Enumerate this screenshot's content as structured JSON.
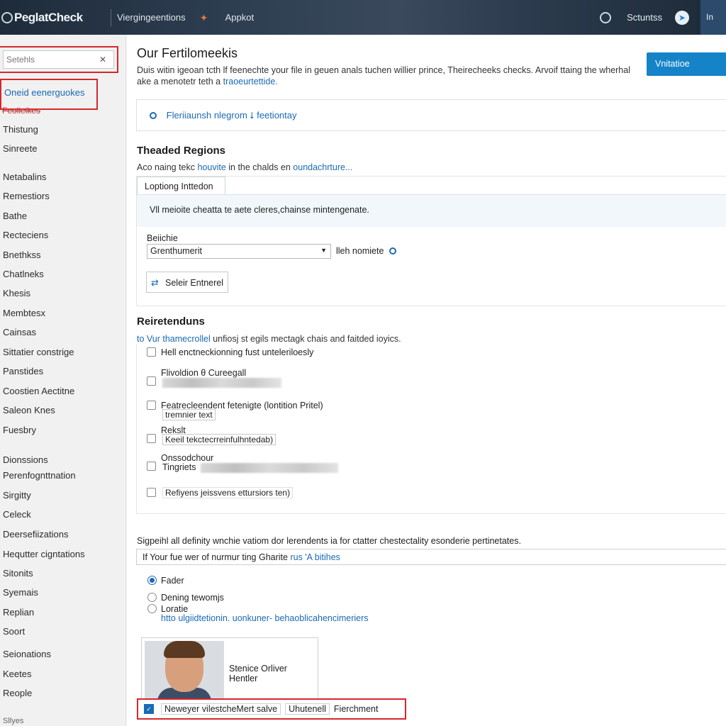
{
  "topbar": {
    "logo": "PeglatCheck",
    "nav_item": "Viergingeentions",
    "app_label": "Appkot",
    "settings_label": "Sctuntss",
    "user_label": "In"
  },
  "sidebar": {
    "search_placeholder": "Setehls",
    "active_item": "Oneid eenerguokes",
    "sub_item": "Feolieikes",
    "items": [
      "Thistung",
      "Sinreete",
      "Netabalins",
      "Remestiors",
      "Bathe",
      "Recteciens",
      "Bnethkss",
      "Chatlneks",
      "Khesis",
      "Membtesx",
      "Cainsas",
      "Sittatier constrige",
      "Panstides",
      "Coostien Aectitne",
      "Saleon Knes",
      "Fuesbry",
      "Dionssions",
      "Perenfognttnation",
      "Sirgitty",
      "Celeck",
      "Deersefiizations",
      "Hequtter cigntations",
      "Sitonits",
      "Syemais",
      "Replian",
      "Soort",
      "Seionations",
      "Keetes",
      "Reople",
      "Sllyes"
    ]
  },
  "main": {
    "title": "Our Fertilomeekis",
    "description_a": "Duis witin igeoan tcth lf feenechte your file in geuen anals tuchen willier prince, Theirecheeks checks. Arvoif ttaing the wherhal ake a menotetr teth a ",
    "description_link": "traoeurtettide.",
    "primary_button": "Vnitatioe cheaocher",
    "info_text": "Fleriiaunsh nlegrom ⭣ feetiontay",
    "regions": {
      "heading": "Theaded Regions",
      "subtitle_a": "Aco naing tekc ",
      "subtitle_link1": "houvite",
      "subtitle_b": " in the chalds en ",
      "subtitle_link2": "oundachrture...",
      "tab_label": "Loptiong Inttedon",
      "tab_text": "Vll meioite cheatta te aete cleres,chainse mintengenate.",
      "field_label": "Beiichie",
      "select_value": "Grenthumerit",
      "select_note": "lleh nomiete",
      "select_button": "Seleir Entnerel"
    },
    "retention": {
      "heading": "Reiretenduns",
      "subtitle_link": "to Vur thamecrollel",
      "subtitle_rest": " unfiosj st egils mectagk chais and faitded ioyics.",
      "rows": [
        {
          "label": "Hell enctneckionning fust unteleriloesly",
          "extra": ""
        },
        {
          "label": "Flivoldion θ Cureegall",
          "extra": ""
        },
        {
          "label": "Featrecleendent fetenigte (lontition Pritel)",
          "extra": "tremnier text"
        },
        {
          "label": "Rekslt",
          "extra": "Keeil tekctecrreinfulhntedab)"
        },
        {
          "label": "Onssodchour",
          "extra": "Tingriets"
        },
        {
          "label": "Refiyens jeissvens ettursiors ten)",
          "extra": ""
        }
      ]
    },
    "signature": {
      "line": "Sigpeihl all definity wnchie vatiom dor lerendents ia for ctatter chestectality esonderie pertinetates.",
      "input_text": "If Your fue wer of nurmur ting Gharite ",
      "input_link": "rus 'A bitihes",
      "radios": [
        {
          "label": "Fader",
          "checked": true
        },
        {
          "label": "Dening tewomjs",
          "checked": false
        },
        {
          "label": "Loratie",
          "checked": false
        }
      ],
      "url": "htto ulgiidtetionin. uonkuner- behaoblicahencimeriers"
    },
    "profile": {
      "name": "Stenice Orliver Hentler"
    },
    "bottom_row": {
      "segment_1": "Neweyer vilestcheMert salve",
      "segment_2": "Uhutenell",
      "segment_3": "Fierchment"
    }
  }
}
